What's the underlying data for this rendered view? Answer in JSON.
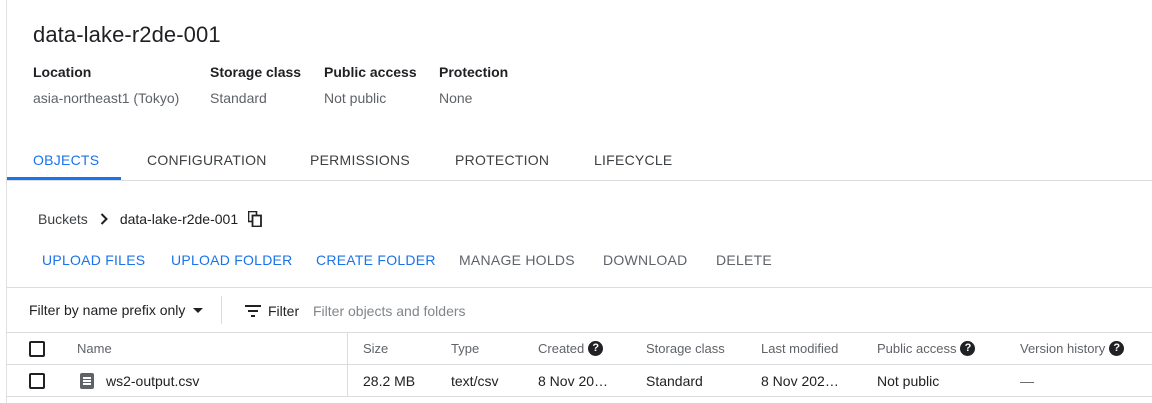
{
  "bucket": {
    "name": "data-lake-r2de-001",
    "info": [
      {
        "label": "Location",
        "value": "asia-northeast1 (Tokyo)"
      },
      {
        "label": "Storage class",
        "value": "Standard"
      },
      {
        "label": "Public access",
        "value": "Not public"
      },
      {
        "label": "Protection",
        "value": "None"
      }
    ]
  },
  "tabs": [
    {
      "label": "OBJECTS",
      "active": true
    },
    {
      "label": "CONFIGURATION",
      "active": false
    },
    {
      "label": "PERMISSIONS",
      "active": false
    },
    {
      "label": "PROTECTION",
      "active": false
    },
    {
      "label": "LIFECYCLE",
      "active": false
    }
  ],
  "breadcrumb": {
    "root": "Buckets",
    "current": "data-lake-r2de-001"
  },
  "actions": [
    {
      "label": "UPLOAD FILES",
      "enabled": true
    },
    {
      "label": "UPLOAD FOLDER",
      "enabled": true
    },
    {
      "label": "CREATE FOLDER",
      "enabled": true
    },
    {
      "label": "MANAGE HOLDS",
      "enabled": false
    },
    {
      "label": "DOWNLOAD",
      "enabled": false
    },
    {
      "label": "DELETE",
      "enabled": false
    }
  ],
  "filter": {
    "prefix_mode": "Filter by name prefix only",
    "label": "Filter",
    "placeholder": "Filter objects and folders"
  },
  "table": {
    "columns": {
      "name": "Name",
      "size": "Size",
      "type": "Type",
      "created": "Created",
      "storage_class": "Storage class",
      "last_modified": "Last modified",
      "public_access": "Public access",
      "version_history": "Version history"
    },
    "rows": [
      {
        "name": "ws2-output.csv",
        "size": "28.2 MB",
        "type": "text/csv",
        "created": "8 Nov 20…",
        "storage_class": "Standard",
        "last_modified": "8 Nov 202…",
        "public_access": "Not public",
        "version_history": "—"
      }
    ]
  },
  "colors": {
    "accent": "#1a73e8",
    "text": "#202124",
    "muted": "#5f6368",
    "border": "#dadce0"
  },
  "icons": [
    "chevron-right-icon",
    "copy-icon",
    "dropdown-caret-icon",
    "filter-list-icon",
    "help-icon",
    "file-icon"
  ]
}
